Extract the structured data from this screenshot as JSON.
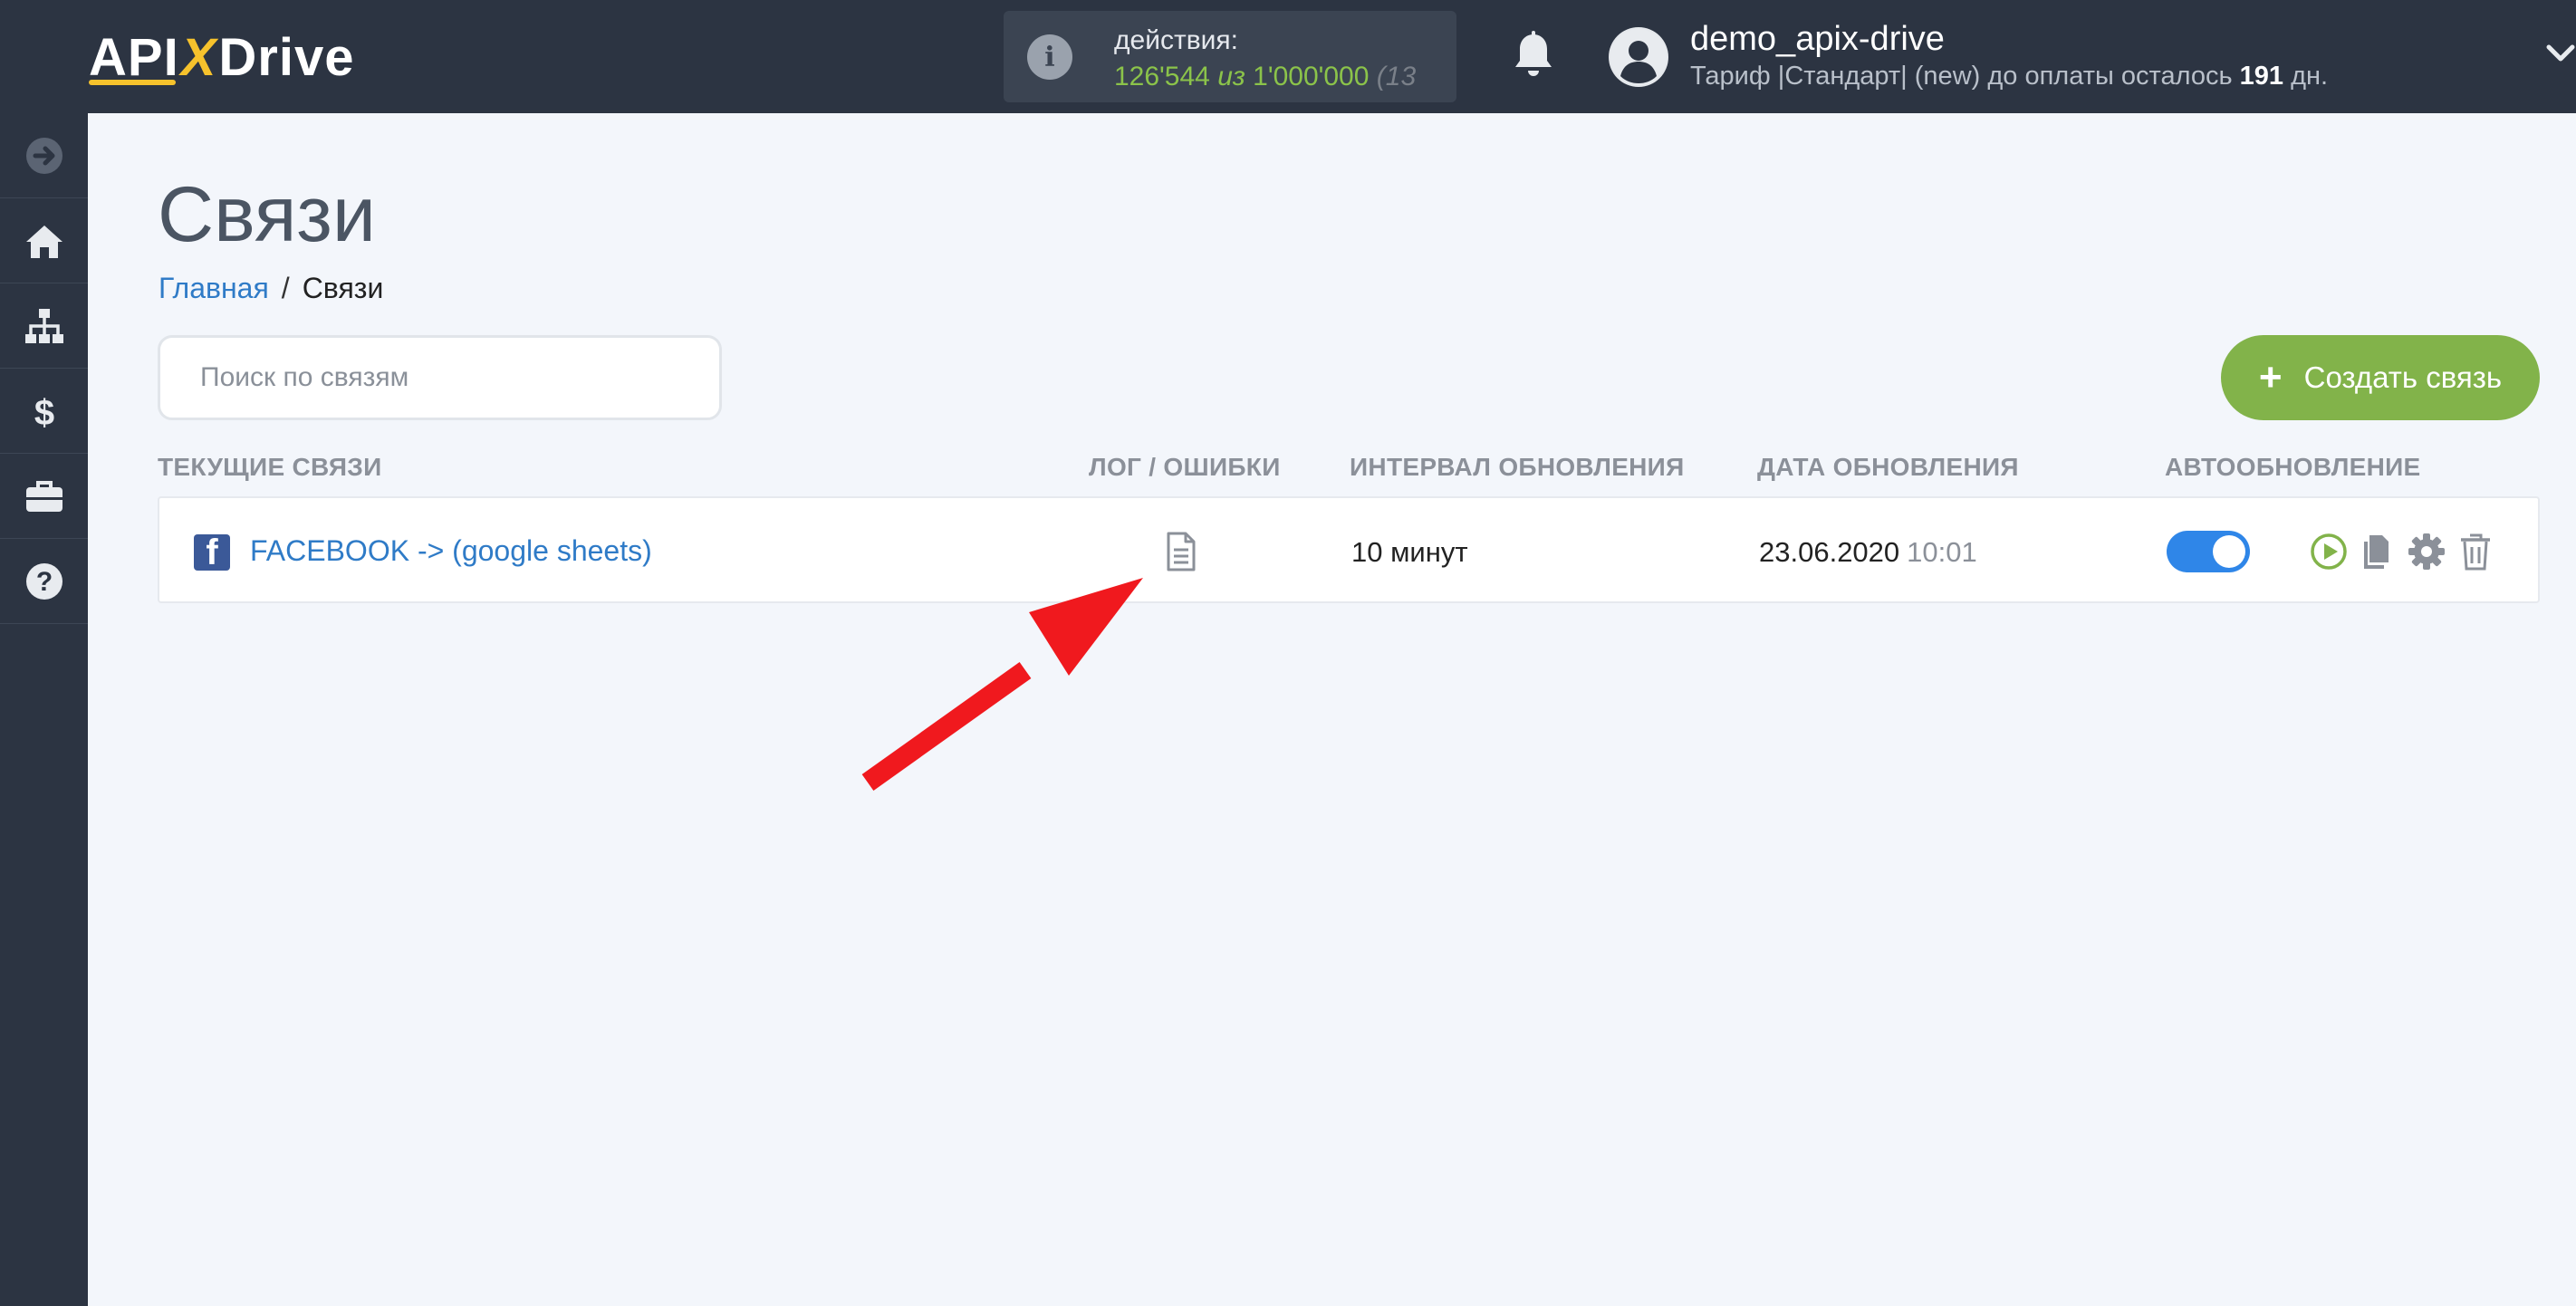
{
  "header": {
    "logo_parts": [
      "API",
      "X",
      "Drive"
    ],
    "actions_label": "действия:",
    "actions_used": "126'544",
    "actions_of": "из",
    "actions_total": "1'000'000",
    "actions_paren": "(13",
    "username": "demo_apix-drive",
    "tariff_prefix": "Тариф |Стандарт| (new) до оплаты осталось",
    "tariff_days": "191",
    "tariff_suffix": "дн."
  },
  "sidebar": {
    "items": [
      {
        "icon": "arrow-right-circle-icon"
      },
      {
        "icon": "home-icon"
      },
      {
        "icon": "sitemap-icon"
      },
      {
        "icon": "dollar-icon"
      },
      {
        "icon": "briefcase-icon"
      },
      {
        "icon": "help-icon"
      }
    ]
  },
  "page": {
    "title": "Связи",
    "breadcrumb": {
      "home": "Главная",
      "separator": "/",
      "current": "Связи"
    },
    "search_placeholder": "Поиск по связям",
    "create_button": "Создать связь"
  },
  "table": {
    "headers": {
      "connections": "ТЕКУЩИЕ СВЯЗИ",
      "log": "ЛОГ / ОШИБКИ",
      "interval": "ИНТЕРВАЛ ОБНОВЛЕНИЯ",
      "date": "ДАТА ОБНОВЛЕНИЯ",
      "auto": "АВТООБНОВЛЕНИЕ"
    },
    "rows": [
      {
        "icon": "facebook-icon",
        "name": "FACEBOOK -> (google sheets)",
        "interval": "10 минут",
        "date": "23.06.2020",
        "time": "10:01",
        "autoupdate": true
      }
    ]
  },
  "colors": {
    "topbar": "#2c3442",
    "accent_green": "#82b34a",
    "link_blue": "#2f7bc7",
    "toggle_blue": "#2f86e8",
    "arrow_red": "#f0191e"
  }
}
